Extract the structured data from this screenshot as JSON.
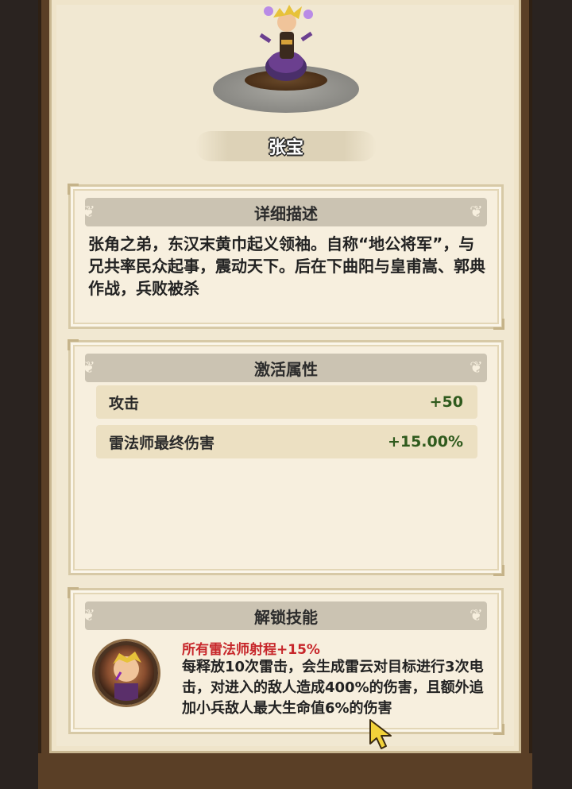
{
  "hero": {
    "name": "张宝",
    "icon": "hero-portrait"
  },
  "description": {
    "title": "详细描述",
    "text": "张角之弟，东汉末黄巾起义领袖。自称“地公将军”，与兄共率民众起事，震动天下。后在下曲阳与皇甫嵩、郭典作战，兵败被杀"
  },
  "attributes": {
    "title": "激活属性",
    "rows": [
      {
        "name": "攻击",
        "value": "+50"
      },
      {
        "name": "雷法师最终伤害",
        "value": "+15.00%"
      }
    ]
  },
  "skill": {
    "title": "解锁技能",
    "name": "所有雷法师射程+15%",
    "text": "每释放10次雷击，会生成雷云对目标进行3次电击，对进入的敌人造成400%的伤害，且额外追加小兵敌人最大生命值6%的伤害",
    "icon": "skill-portrait-icon"
  },
  "colors": {
    "accent_red": "#c7262a",
    "value_green": "#2f5a1d",
    "panel_bg": "#f7efde"
  }
}
